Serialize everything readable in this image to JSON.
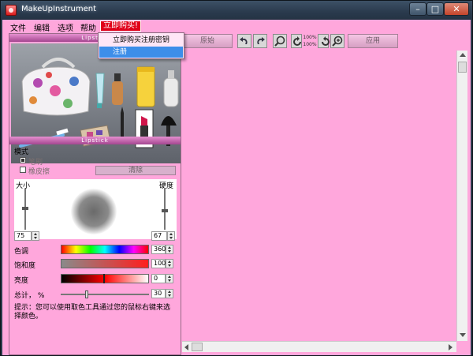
{
  "window": {
    "title": "MakeUpInstrument"
  },
  "menu": {
    "items": [
      "文件",
      "编辑",
      "选项",
      "帮助"
    ],
    "buy": "立即购买!"
  },
  "popup": {
    "items": [
      "立即购买注册密钥",
      "注册"
    ]
  },
  "toolbar": {
    "original_label": "原始",
    "apply_label": "应用",
    "zoom_top": "100%",
    "zoom_bottom": "100%"
  },
  "left_panel": {
    "top_header": "Lipstick",
    "section_header": "Lipstick",
    "mode_label": "模式",
    "brush_label": "笔刷",
    "eraser_label": "橡皮擦",
    "clear_label": "清除",
    "size_label": "大小",
    "hardness_label": "硬度",
    "size_value": "75",
    "hardness_value": "67",
    "hue_label": "色调",
    "hue_value": "360",
    "saturation_label": "饱和度",
    "saturation_value": "100",
    "brightness_label": "亮度",
    "brightness_value": "0",
    "total_label": "总计， %",
    "total_value": "30",
    "hint": "提示：您可以使用取色工具通过您的鼠标右键来选择颜色。"
  },
  "colors": {
    "background": "#ffa7dc",
    "popup_highlight": "#3d8ee9",
    "buy_red": "#e0001a"
  }
}
